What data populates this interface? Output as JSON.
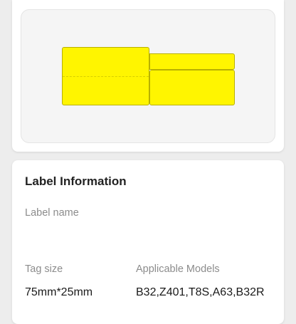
{
  "preview": {
    "label_color": "#fff500"
  },
  "info": {
    "title": "Label Information",
    "label_name_caption": "Label name",
    "label_name_value": "",
    "tag_size_caption": "Tag size",
    "tag_size_value": "75mm*25mm",
    "models_caption": "Applicable Models",
    "models_value": "B32,Z401,T8S,A63,B32R"
  }
}
